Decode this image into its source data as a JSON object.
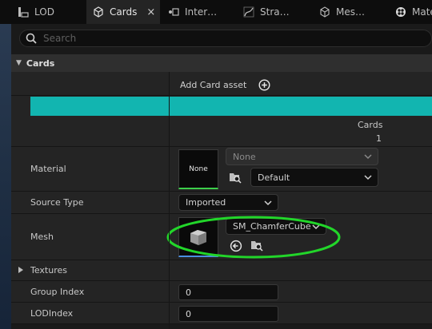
{
  "tabs": [
    {
      "label": "LOD",
      "icon": "lod-icon"
    },
    {
      "label": "Cards",
      "icon": "cards-icon",
      "active": true,
      "close": "×"
    },
    {
      "label": "Inter…",
      "icon": "interpolation-icon"
    },
    {
      "label": "Stra…",
      "icon": "strands-icon"
    },
    {
      "label": "Mes…",
      "icon": "mesh-icon"
    },
    {
      "label": "Mate",
      "icon": "material-icon"
    }
  ],
  "search": {
    "placeholder": "Search"
  },
  "section": {
    "title": "Cards"
  },
  "add_card": {
    "label": "Add Card asset"
  },
  "cards_count": {
    "header": "Cards",
    "value": "1"
  },
  "material": {
    "label": "Material",
    "thumb_text": "None",
    "slot_value": "None",
    "value": "Default"
  },
  "source_type": {
    "label": "Source Type",
    "value": "Imported"
  },
  "mesh": {
    "label": "Mesh",
    "value": "SM_ChamferCube"
  },
  "textures": {
    "label": "Textures"
  },
  "group_index": {
    "label": "Group Index",
    "value": "0"
  },
  "lod_index": {
    "label": "LODIndex",
    "value": "0"
  },
  "colors": {
    "accent_bar": "#12b5b0",
    "highlight_ellipse": "#22d62a"
  }
}
